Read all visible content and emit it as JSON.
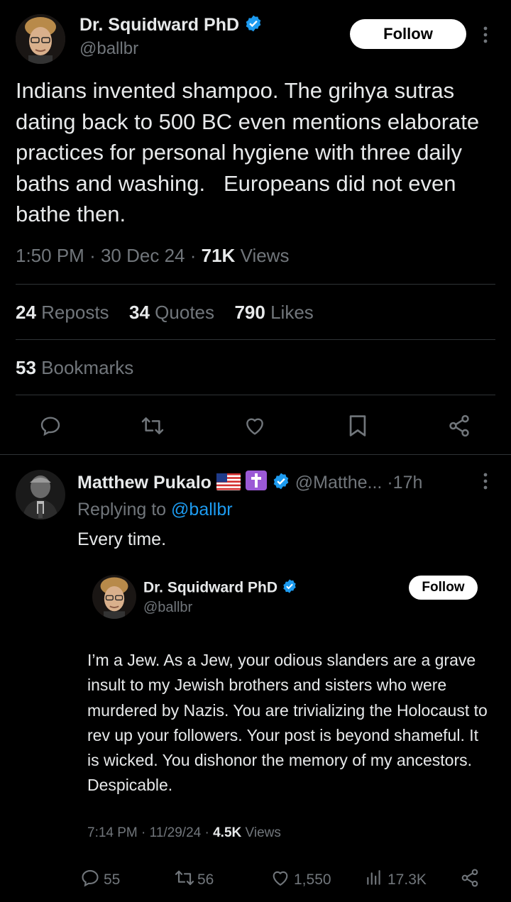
{
  "main_tweet": {
    "author_name": "Dr. Squidward PhD",
    "author_handle": "@ballbr",
    "follow_label": "Follow",
    "text": "Indians invented shampoo. The grihya sutras dating back to 500 BC even mentions elaborate practices for personal hygiene with three daily baths and washing.   Europeans did not even bathe then.",
    "time": "1:50 PM",
    "date": "30 Dec 24",
    "views_count": "71K",
    "views_label": "Views",
    "reposts_count": "24",
    "reposts_label": "Reposts",
    "quotes_count": "34",
    "quotes_label": "Quotes",
    "likes_count": "790",
    "likes_label": "Likes",
    "bookmarks_count": "53",
    "bookmarks_label": "Bookmarks",
    "actions": [
      "reply-icon",
      "repost-icon",
      "like-icon",
      "bookmark-icon",
      "share-icon"
    ]
  },
  "reply": {
    "author_name": "Matthew Pukalo",
    "flag_emoji": "🇺🇸",
    "cross_emoji": "✝",
    "author_handle": "@Matthe...",
    "time_ago": "17h",
    "replying_prefix": "Replying to",
    "replying_handle": "@ballbr",
    "text": "Every time."
  },
  "embedded": {
    "author_name": "Dr. Squidward PhD",
    "author_handle": "@ballbr",
    "follow_label": "Follow",
    "text": "I’m a Jew. As a Jew, your odious slanders are a grave insult to my Jewish brothers and sisters who were murdered by Nazis. You are trivializing the Holocaust to rev up your followers. Your post is beyond shameful. It is wicked. You dishonor the memory of my ancestors. Despicable.",
    "time": "7:14 PM",
    "date": "11/29/24",
    "views_count": "4.5K",
    "views_label": "Views",
    "replies": "55",
    "reposts": "56",
    "likes": "1,550",
    "views": "17.3K"
  },
  "colors": {
    "background": "#000000",
    "text": "#e7e9ea",
    "muted": "#71767b",
    "accent": "#1d9bf0",
    "divider": "#2f3336"
  }
}
